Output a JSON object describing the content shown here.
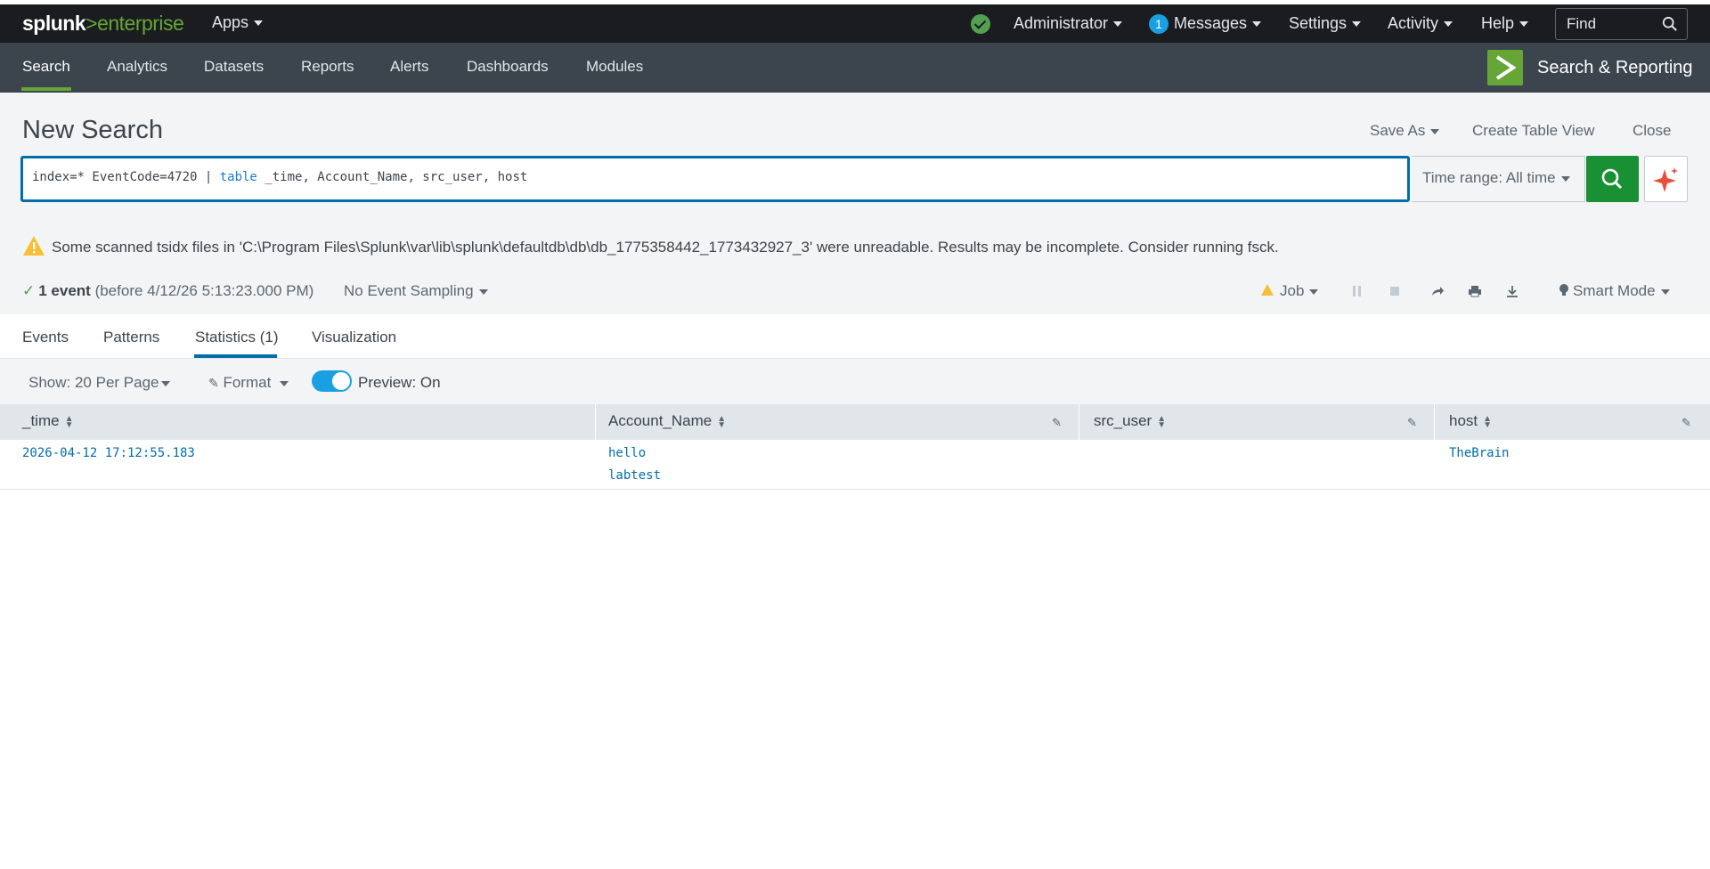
{
  "topbar": {
    "logo_prefix": "splunk",
    "logo_gt": ">",
    "logo_suffix": "enterprise",
    "apps_label": "Apps",
    "admin_label": "Administrator",
    "messages_count": "1",
    "messages_label": "Messages",
    "settings_label": "Settings",
    "activity_label": "Activity",
    "help_label": "Help",
    "find_placeholder": "Find"
  },
  "nav": {
    "items": [
      {
        "label": "Search"
      },
      {
        "label": "Analytics"
      },
      {
        "label": "Datasets"
      },
      {
        "label": "Reports"
      },
      {
        "label": "Alerts"
      },
      {
        "label": "Dashboards"
      },
      {
        "label": "Modules"
      }
    ],
    "app_title": "Search & Reporting"
  },
  "header": {
    "title": "New Search",
    "save_as": "Save As",
    "create_table_view": "Create Table View",
    "close": "Close"
  },
  "search": {
    "query_prefix": "index=* EventCode=4720 | ",
    "query_keyword": "table",
    "query_suffix": " _time, Account_Name, src_user, host",
    "time_range": "Time range: All time"
  },
  "warning": {
    "text": "Some scanned tsidx files in 'C:\\Program Files\\Splunk\\var\\lib\\splunk\\defaultdb\\db\\db_1775358442_1773432927_3' were unreadable. Results may be incomplete. Consider running fsck."
  },
  "status": {
    "count": "1 event",
    "detail": " (before 4/12/26 5:13:23.000 PM)",
    "sampling": "No Event Sampling",
    "job": "Job",
    "mode": "Smart Mode"
  },
  "tabs": {
    "items": [
      {
        "label": "Events"
      },
      {
        "label": "Patterns"
      },
      {
        "label": "Statistics (1)"
      },
      {
        "label": "Visualization"
      }
    ]
  },
  "toolbar": {
    "show": "Show: 20 Per Page",
    "format": "Format",
    "preview": "Preview: On"
  },
  "table": {
    "columns": [
      "_time",
      "Account_Name",
      "src_user",
      "host"
    ],
    "rows": [
      {
        "time": "2026-04-12 17:12:55.183",
        "account_1": "hello",
        "account_2": "labtest",
        "src_user": "",
        "host": "TheBrain"
      }
    ]
  },
  "colors": {
    "accent_green": "#65a637",
    "search_blue": "#006eaa",
    "search_btn": "#1a9035",
    "warning": "#f8be34"
  }
}
